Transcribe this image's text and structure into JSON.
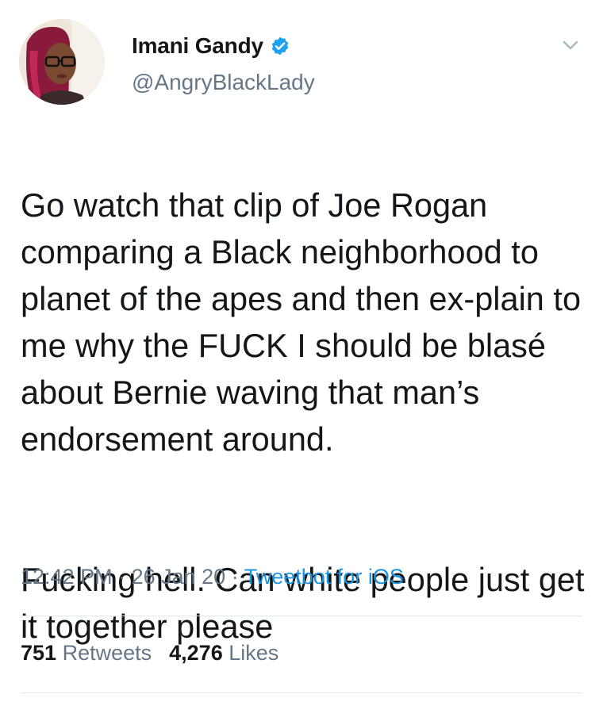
{
  "author": {
    "display_name": "Imani Gandy",
    "handle": "@AngryBlackLady",
    "verified": true
  },
  "tweet": {
    "paragraph_1": "Go watch that clip of Joe Rogan comparing a Black neighborhood to planet of the apes and then ex-plain to me why the FUCK I should be blasé  about Bernie waving that man’s endorsement around.",
    "paragraph_2": "Fucking hell. Can white people just get it together please",
    "time": "12:42 PM",
    "date": "26 Jan 20",
    "separator": "·",
    "source": "Tweetbot for iOS"
  },
  "stats": {
    "retweets_count": "751",
    "retweets_label": "Retweets",
    "likes_count": "4,276",
    "likes_label": "Likes"
  },
  "icons": {
    "verified": "verified-badge-icon",
    "caret": "chevron-down-icon"
  },
  "colors": {
    "text": "#14171a",
    "secondary": "#657786",
    "link": "#1b95e0",
    "verified": "#1da1f2",
    "divider": "#e1e8ed"
  }
}
